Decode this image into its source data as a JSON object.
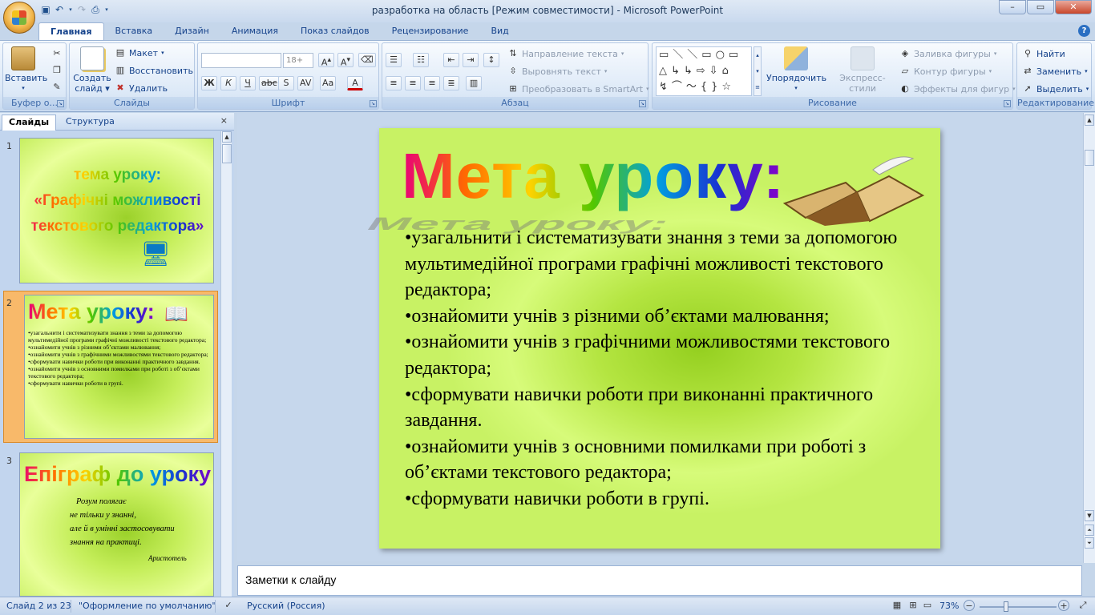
{
  "window": {
    "title": "разработка на область [Режим совместимости] - Microsoft PowerPoint",
    "buttons": [
      "minimize",
      "maximize",
      "close"
    ]
  },
  "quick_access": [
    "save-icon",
    "undo-icon",
    "redo-icon",
    "print-preview-icon",
    "customize-icon"
  ],
  "tabs": [
    "Главная",
    "Вставка",
    "Дизайн",
    "Анимация",
    "Показ слайдов",
    "Рецензирование",
    "Вид"
  ],
  "active_tab": "Главная",
  "ribbon": {
    "clipboard": {
      "label": "Буфер о...",
      "paste": "Вставить"
    },
    "slides": {
      "label": "Слайды",
      "new_slide_1": "Создать",
      "new_slide_2": "слайд",
      "layout": "Макет",
      "reset": "Восстановить",
      "delete": "Удалить"
    },
    "font": {
      "label": "Шрифт",
      "font_name": "",
      "font_size": "18+"
    },
    "paragraph": {
      "label": "Абзац",
      "text_direction": "Направление текста",
      "align_text": "Выровнять текст",
      "smartart": "Преобразовать в SmartArt"
    },
    "drawing": {
      "label": "Рисование",
      "arrange": "Упорядочить",
      "quick_styles": "Экспресс-стили",
      "fill": "Заливка фигуры",
      "outline": "Контур фигуры",
      "effects": "Эффекты для фигур"
    },
    "editing": {
      "label": "Редактирование",
      "find": "Найти",
      "replace": "Заменить",
      "select": "Выделить"
    }
  },
  "left_pane": {
    "tabs": [
      "Слайды",
      "Структура"
    ],
    "active_tab": "Слайды",
    "thumbnails": [
      {
        "number": "1",
        "lines": [
          "тема уроку:",
          "«Графічні можливості",
          "текстового редактора»"
        ]
      },
      {
        "number": "2",
        "title": "Мета уроку:",
        "selected": true
      },
      {
        "number": "3",
        "title": "Епіграф до уроку",
        "quote": [
          "Розум полягає",
          "не тільки у знанні,",
          "але й в умінні застосовувати",
          "знання на практиці."
        ],
        "author": "Аристотель"
      }
    ]
  },
  "slide": {
    "title": "Мета уроку:",
    "bullets": [
      "•узагальнити і систематизувати знання з теми за допомогою мультимедійної програми графічні можливості текстового редактора;",
      "•ознайомити учнів з різними об’єктами малювання;",
      "•ознайомити учнів з графічними можливостями текстового редактора;",
      "•сформувати навички роботи при виконанні практичного завдання.",
      "•ознайомити учнів з основними помилками при роботі з об’єктами текстового редактора;",
      "•сформувати навички роботи в групі."
    ]
  },
  "notes": {
    "placeholder": "Заметки к слайду"
  },
  "status_bar": {
    "slide_info": "Слайд 2 из 23",
    "theme": "\"Оформление по умолчанию\"",
    "language": "Русский (Россия)",
    "zoom": "73%"
  },
  "colors": {
    "accent": "#15428b",
    "slide_bg": "#c8f264",
    "selection": "#f8b96a"
  }
}
